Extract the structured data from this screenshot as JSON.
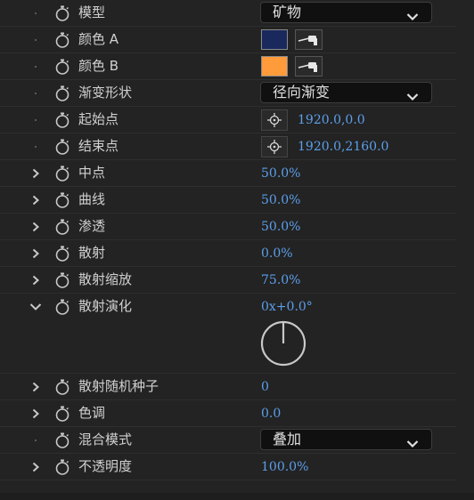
{
  "properties": [
    {
      "id": "model",
      "label": "模型",
      "twirl": "dot",
      "kind": "dropdown",
      "value": "矿物"
    },
    {
      "id": "color-a",
      "label": "颜色 A",
      "twirl": "dot",
      "kind": "color",
      "color": "#19295e"
    },
    {
      "id": "color-b",
      "label": "颜色 B",
      "twirl": "dot",
      "kind": "color",
      "color": "#ff9b3a"
    },
    {
      "id": "gradient-shape",
      "label": "渐变形状",
      "twirl": "dot",
      "kind": "dropdown",
      "value": "径向渐变"
    },
    {
      "id": "start-point",
      "label": "起始点",
      "twirl": "dot",
      "kind": "point",
      "value": "1920.0,0.0"
    },
    {
      "id": "end-point",
      "label": "结束点",
      "twirl": "dot",
      "kind": "point",
      "value": "1920.0,2160.0"
    },
    {
      "id": "midpoint",
      "label": "中点",
      "twirl": "closed",
      "kind": "number",
      "value": "50.0%"
    },
    {
      "id": "curve",
      "label": "曲线",
      "twirl": "closed",
      "kind": "number",
      "value": "50.0%"
    },
    {
      "id": "penetration",
      "label": "渗透",
      "twirl": "closed",
      "kind": "number",
      "value": "50.0%"
    },
    {
      "id": "scatter",
      "label": "散射",
      "twirl": "closed",
      "kind": "number",
      "value": "0.0%"
    },
    {
      "id": "scatter-scale",
      "label": "散射缩放",
      "twirl": "closed",
      "kind": "number",
      "value": "75.0%"
    },
    {
      "id": "scatter-evolution",
      "label": "散射演化",
      "twirl": "open",
      "kind": "angle",
      "value": "0x+0.0°",
      "angle_deg": 0
    },
    {
      "id": "scatter-seed",
      "label": "散射随机种子",
      "twirl": "closed",
      "kind": "number",
      "value": "0"
    },
    {
      "id": "hue",
      "label": "色调",
      "twirl": "closed",
      "kind": "number",
      "value": "0.0"
    },
    {
      "id": "blend-mode",
      "label": "混合模式",
      "twirl": "dot",
      "kind": "dropdown",
      "value": "叠加"
    },
    {
      "id": "opacity",
      "label": "不透明度",
      "twirl": "closed",
      "kind": "number",
      "value": "100.0%"
    }
  ],
  "icons": {
    "stopwatch": "stopwatch-icon",
    "eyedropper": "eyedropper-icon",
    "point": "crosshair-icon",
    "dropdown": "chevron-down-icon"
  },
  "colors": {
    "panel_bg": "#232323",
    "value_blue": "#5c9fea",
    "label": "#d0d0d0"
  }
}
